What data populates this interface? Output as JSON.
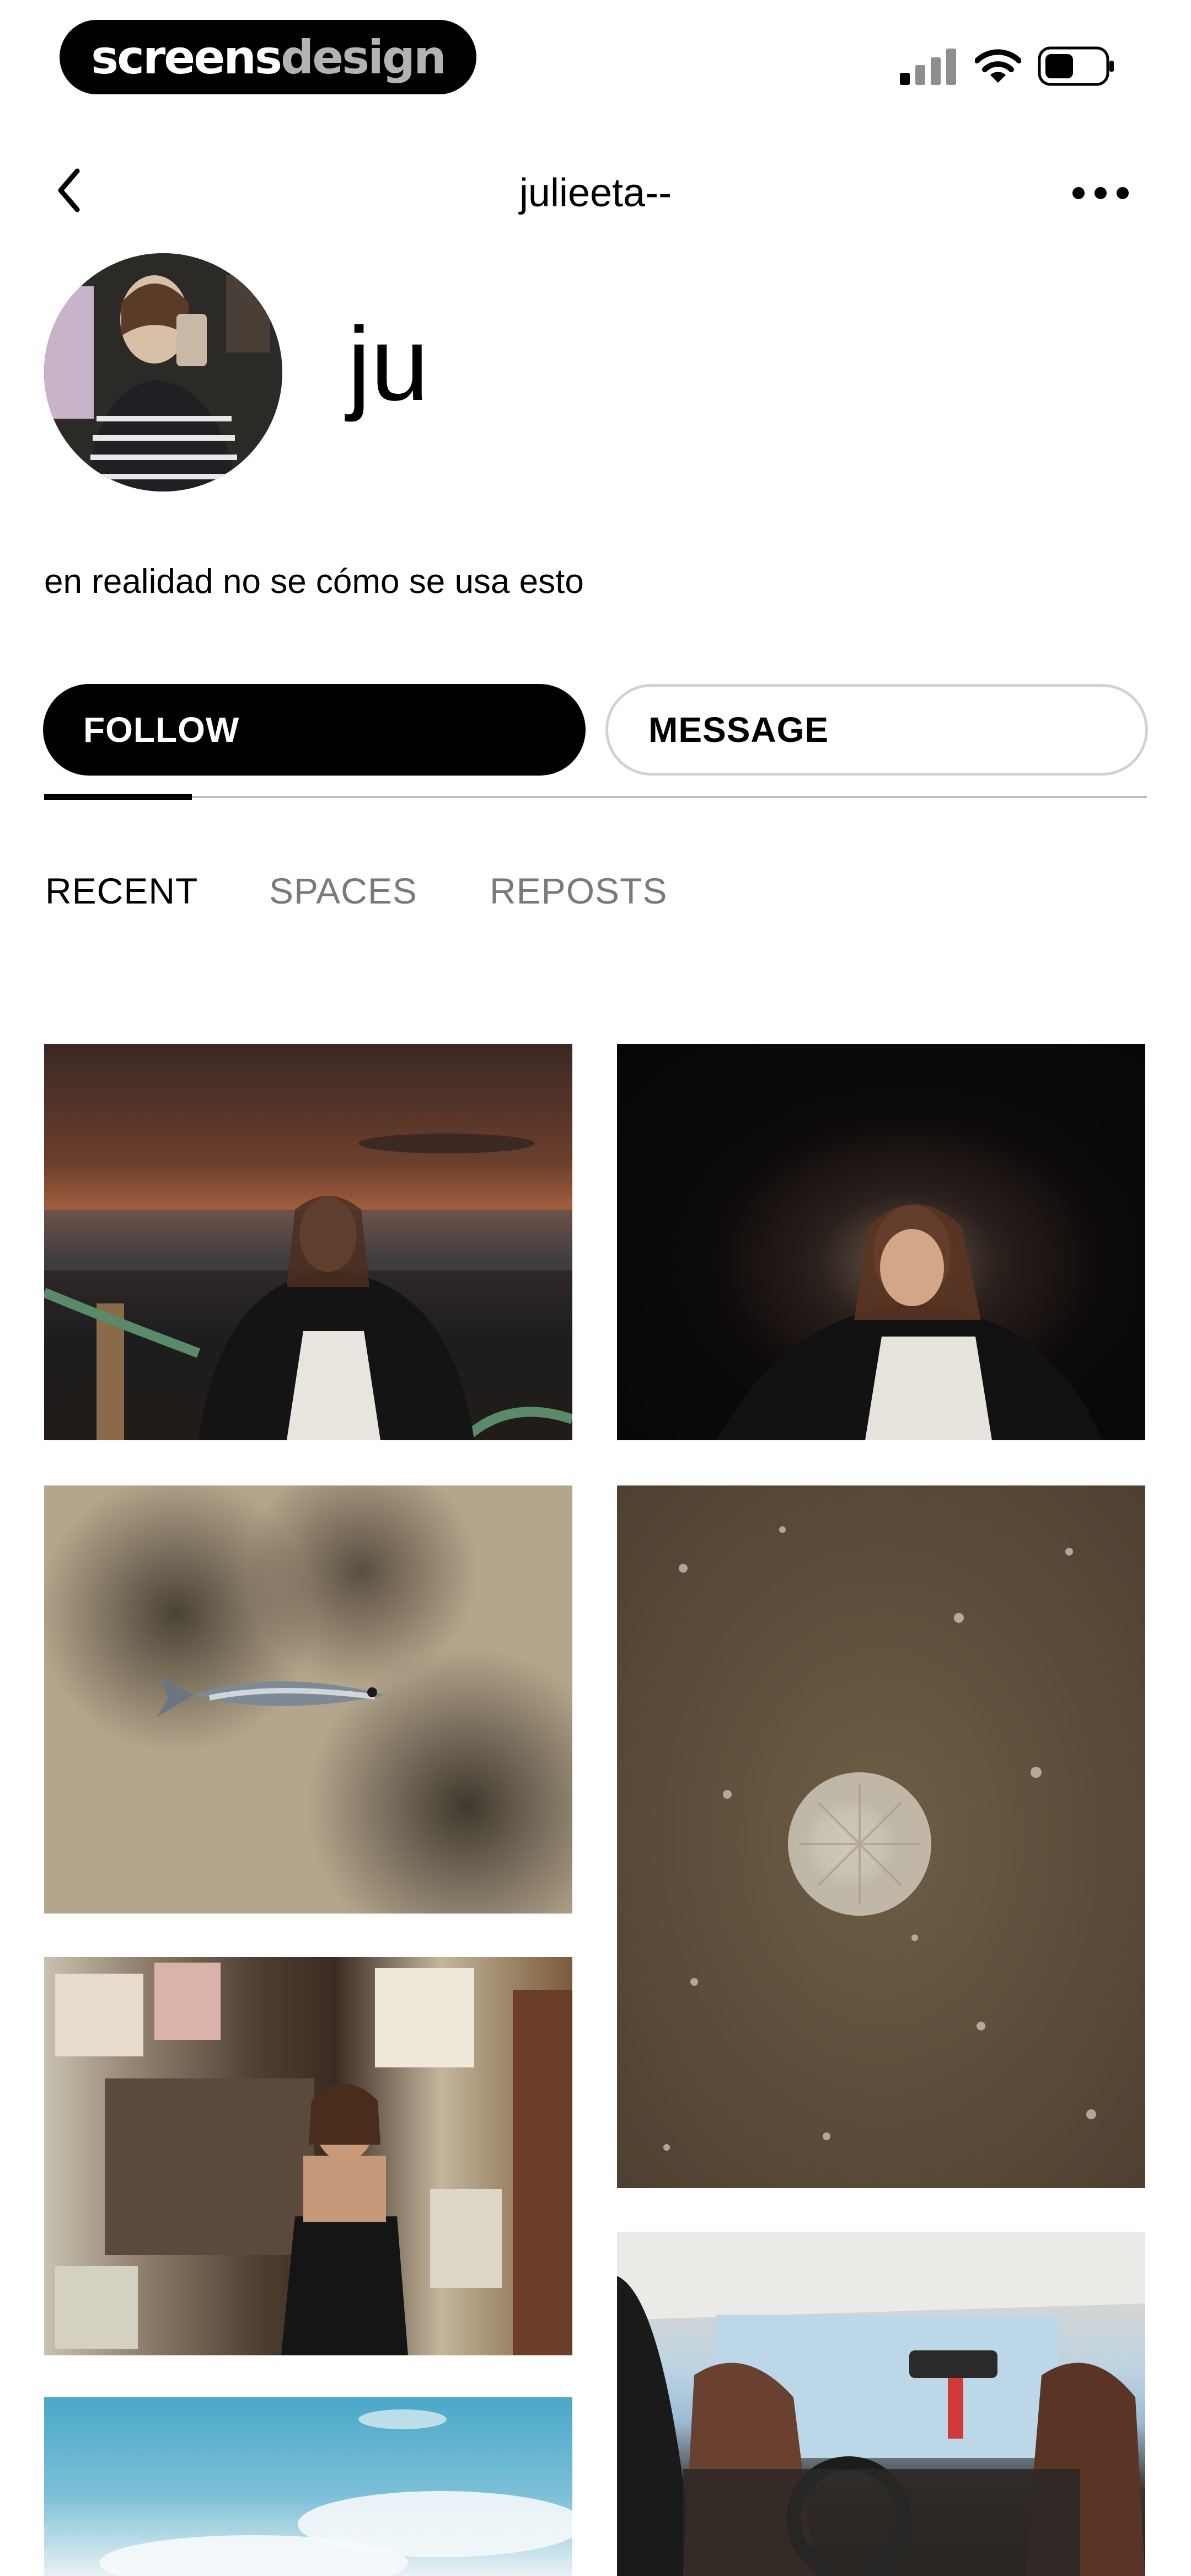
{
  "status_bar": {
    "brand": {
      "part1": "screens",
      "part2": "design"
    },
    "icons": [
      "cellular-signal-icon",
      "wifi-icon",
      "battery-icon"
    ]
  },
  "header": {
    "username": "julieeta--",
    "icons": {
      "back": "chevron-left-icon",
      "more": "more-horizontal-icon"
    }
  },
  "profile": {
    "display_name": "ju",
    "bio": "en realidad no se cómo se usa esto"
  },
  "actions": {
    "follow_label": "FOLLOW",
    "message_label": "MESSAGE"
  },
  "tabs": [
    {
      "label": "RECENT",
      "active": true
    },
    {
      "label": "SPACES",
      "active": false
    },
    {
      "label": "REPOSTS",
      "active": false
    }
  ],
  "posts": [
    {
      "subject": "sunset-beach-portrait"
    },
    {
      "subject": "night-portrait"
    },
    {
      "subject": "fish-on-sand"
    },
    {
      "subject": "jellyfish-on-sand"
    },
    {
      "subject": "poster-wall-portrait"
    },
    {
      "subject": "car-interior"
    },
    {
      "subject": "sky"
    }
  ]
}
